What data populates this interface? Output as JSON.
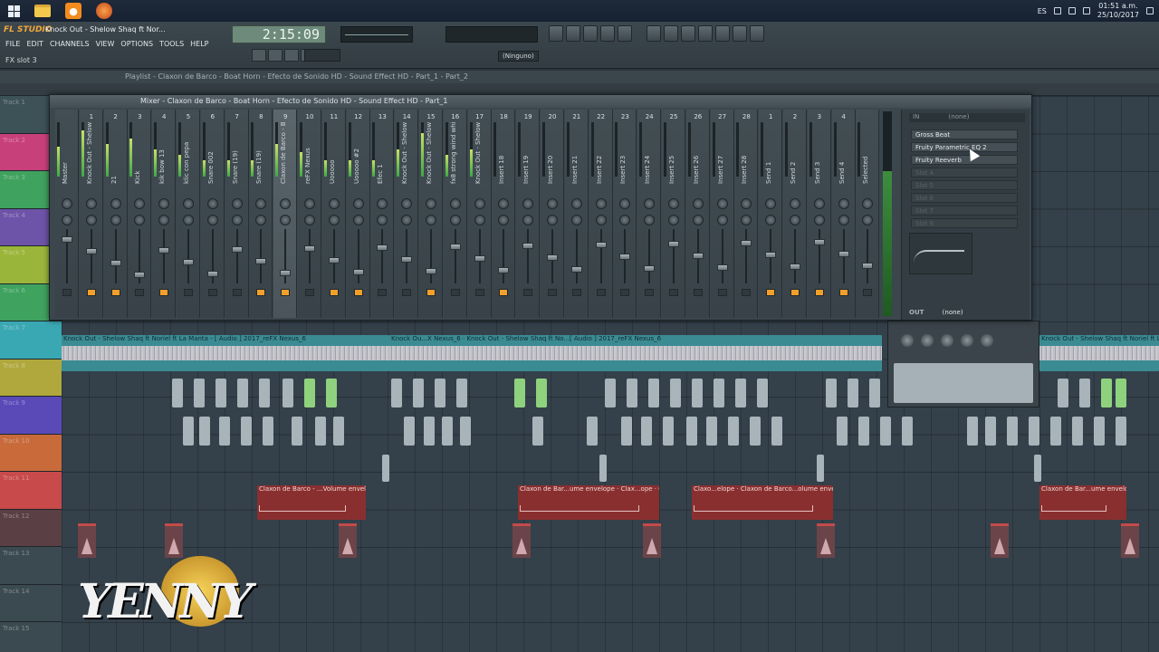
{
  "taskbar": {
    "tray": {
      "lang": "ES",
      "time": "01:51 a.m.",
      "date": "25/10/2017"
    },
    "icons": [
      "windows-logo",
      "file-explorer-icon",
      "fl-studio-icon",
      "firefox-icon"
    ]
  },
  "fl": {
    "logo": "FL STUDIO",
    "song": "Knock Out - Shelow Shaq ft Nor...",
    "menus": [
      "FILE",
      "EDIT",
      "CHANNELS",
      "VIEW",
      "OPTIONS",
      "TOOLS",
      "HELP"
    ],
    "hint": "FX slot 3",
    "time": "2:15:09",
    "output_device": "(Ninguno)"
  },
  "playlist": {
    "title": "Playlist - Claxon de Barco - Boat Horn - Efecto de Sonido HD - Sound Effect HD - Part_1 - Part_2",
    "tracks": [
      "Track 1",
      "Track 2",
      "Track 3",
      "Track 4",
      "Track 5",
      "Track 6",
      "Track 7",
      "Track 8",
      "Track 9",
      "Track 10",
      "Track 11",
      "Track 12",
      "Track 13",
      "Track 14",
      "Track 15"
    ],
    "audio_clip": "Knock Out - Shelow Shaq ft Noriel ft La Manta - [ Audio ] 2017_reFX Nexus_6",
    "audio_clip_2": "Knock Ou...X Nexus_6 · Knock Out - Shelow Shaq ft No...[ Audio ] 2017_reFX Nexus_6",
    "audio_clip_3": "Knock Out - Shelow Sh",
    "audio_clip_4": "Knock Out - Shelow Shaq ft Noriel ft La Manta - [ Audio ] 2017_reFX Nexus_6",
    "env_clip_1": "Claxon de Barco - ...Volume envelope",
    "env_clip_2": "Claxon de Bar...ume envelope · Clax...ope · Cl...e",
    "env_clip_3": "Claxo...elope · Claxon de Barco...olume envelope",
    "env_clip_4": "Claxon de Bar...ume envelope"
  },
  "mixer": {
    "title": "Mixer - Claxon de Barco - Boat Horn - Efecto de Sonido HD - Sound Effect HD - Part_1",
    "strips": [
      {
        "num": "",
        "name": "Master",
        "level": 0.55
      },
      {
        "num": "1",
        "name": "Knock Out - Shelow Sh",
        "level": 0.85
      },
      {
        "num": "2",
        "name": "21",
        "level": 0.6
      },
      {
        "num": "3",
        "name": "Kick",
        "level": 0.7
      },
      {
        "num": "4",
        "name": "kik bow 13",
        "level": 0.5
      },
      {
        "num": "5",
        "name": "klic con pepa",
        "level": 0.4
      },
      {
        "num": "6",
        "name": "Snare 002",
        "level": 0.3
      },
      {
        "num": "7",
        "name": "Snare (19)",
        "level": 0.3
      },
      {
        "num": "8",
        "name": "Snare (19)",
        "level": 0.3
      },
      {
        "num": "9",
        "name": "Claxon de Barco - Bo",
        "level": 0.6
      },
      {
        "num": "10",
        "name": "reFX Nexus",
        "level": 0.45
      },
      {
        "num": "11",
        "name": "Uooooo",
        "level": 0.3
      },
      {
        "num": "12",
        "name": "Uooooo #2",
        "level": 0.3
      },
      {
        "num": "13",
        "name": "Efec 1",
        "level": 0.3
      },
      {
        "num": "14",
        "name": "Knock Out - Shelow Sh",
        "level": 0.5
      },
      {
        "num": "15",
        "name": "Knock Out - Shelow Sh",
        "level": 0.8
      },
      {
        "num": "16",
        "name": "fx8 strong wind whiss",
        "level": 0.4
      },
      {
        "num": "17",
        "name": "Knock Out - Shelow Sh",
        "level": 0.5
      },
      {
        "num": "18",
        "name": "Insert 18",
        "level": 0
      },
      {
        "num": "19",
        "name": "Insert 19",
        "level": 0
      },
      {
        "num": "20",
        "name": "Insert 20",
        "level": 0
      },
      {
        "num": "21",
        "name": "Insert 21",
        "level": 0
      },
      {
        "num": "22",
        "name": "Insert 22",
        "level": 0
      },
      {
        "num": "23",
        "name": "Insert 23",
        "level": 0
      },
      {
        "num": "24",
        "name": "Insert 24",
        "level": 0
      },
      {
        "num": "25",
        "name": "Insert 25",
        "level": 0
      },
      {
        "num": "26",
        "name": "Insert 26",
        "level": 0
      },
      {
        "num": "27",
        "name": "Insert 27",
        "level": 0
      },
      {
        "num": "28",
        "name": "Insert 28",
        "level": 0
      },
      {
        "num": "1",
        "name": "Send 1",
        "level": 0
      },
      {
        "num": "2",
        "name": "Send 2",
        "level": 0
      },
      {
        "num": "3",
        "name": "Send 3",
        "level": 0
      },
      {
        "num": "4",
        "name": "Send 4",
        "level": 0
      },
      {
        "num": "",
        "name": "Selected",
        "level": 0
      }
    ],
    "fx_slots": [
      "Gross Beat",
      "Fruity Parametric EQ 2",
      "Fruity Reeverb",
      "Slot 4",
      "Slot 5",
      "Slot 6",
      "Slot 7",
      "Slot 8"
    ],
    "in_label": "IN",
    "in_value": "(none)",
    "out_label": "OUT",
    "out_value": "(none)"
  },
  "watermark": {
    "text": "YENNY"
  }
}
